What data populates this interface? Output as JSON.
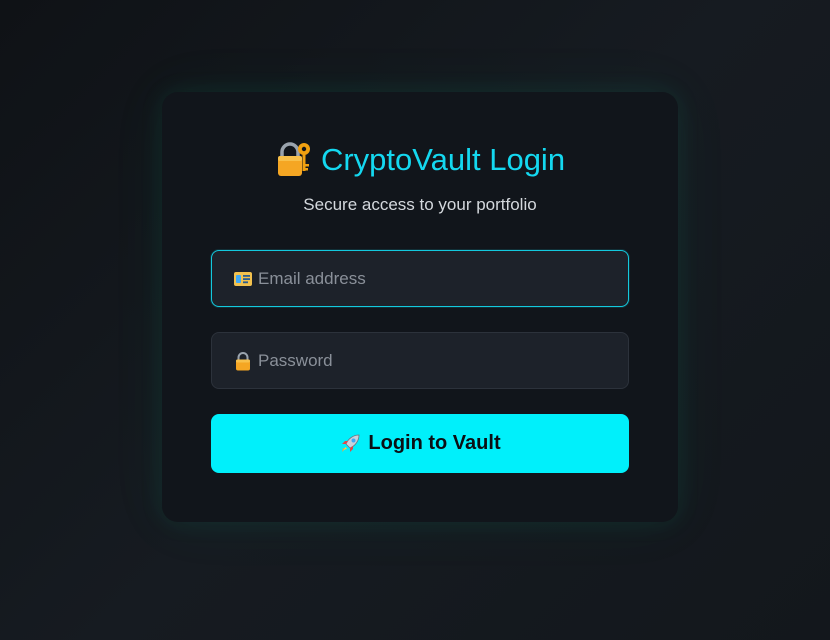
{
  "login_card": {
    "title": "CryptoVault Login",
    "title_icon": "lock-with-key-icon",
    "subtitle": "Secure access to your portfolio",
    "email_field": {
      "icon": "id-card-icon",
      "placeholder": "Email address",
      "value": ""
    },
    "password_field": {
      "icon": "lock-icon",
      "placeholder": "Password",
      "value": ""
    },
    "submit_button": {
      "icon": "rocket-icon",
      "label": "Login to Vault"
    }
  },
  "colors": {
    "accent": "#14d8f0",
    "button": "#00f0fb",
    "card_background": "#11151b",
    "page_background": "#13171c"
  }
}
